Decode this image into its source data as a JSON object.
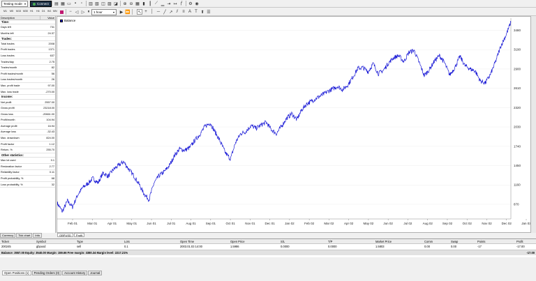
{
  "toolbar": {
    "mode": "Testing mode",
    "connect_label": "Connect",
    "timeframes": [
      "M1",
      "M5",
      "M15",
      "M30",
      "H1",
      "H4",
      "D1",
      "W1",
      "MN"
    ],
    "period": "1 hour"
  },
  "stats": {
    "col_description": "Description",
    "col_value": "Value",
    "sections": [
      {
        "title": "Time:",
        "rows": [
          [
            "Days left",
            "731"
          ],
          [
            "Months left",
            "24.37"
          ]
        ]
      },
      {
        "title": "Trades:",
        "rows": [
          [
            "Total trades",
            "2008"
          ],
          [
            "Profit trades",
            "1371"
          ],
          [
            "Loss trades",
            "637"
          ],
          [
            "Trades/day",
            "2.75"
          ],
          [
            "Trades/month",
            "82"
          ],
          [
            "Profit trades/month",
            "56"
          ],
          [
            "Loss trades/month",
            "26"
          ],
          [
            "Max. profit trade",
            "97.00"
          ],
          [
            "Max. loss trade",
            "-270.00"
          ]
        ]
      },
      {
        "title": "Income:",
        "rows": [
          [
            "Net profit",
            "2557.00"
          ],
          [
            "Gross profit",
            "23218.00"
          ],
          [
            "Gross loss",
            "-20661.00"
          ],
          [
            "Profit/month",
            "104.94"
          ],
          [
            "Average profit",
            "16.94"
          ],
          [
            "Average loss",
            "-32.43"
          ],
          [
            "Max. drawdown",
            "824.00"
          ],
          [
            "Profit factor",
            "1.12"
          ],
          [
            "Return, %",
            "255.70"
          ]
        ]
      },
      {
        "title": "Other statistics:",
        "rows": [
          [
            "Max lot used",
            "0.1"
          ],
          [
            "Restoration factor",
            "2.77"
          ],
          [
            "Reliability factor",
            "0.11"
          ],
          [
            "Profit probability, %",
            "68"
          ],
          [
            "Loss probability, %",
            "32"
          ]
        ]
      }
    ]
  },
  "left_tabs": [
    "Currency",
    "Tick chart",
    "Info"
  ],
  "chart_tabs": [
    "GBPUSD",
    "Profit"
  ],
  "chart_data": {
    "type": "line",
    "series": [
      {
        "name": "Balance",
        "color": "#1a1ad6"
      }
    ],
    "x_ticks": [
      "Feb 01",
      "Mar 01",
      "Apr 01",
      "May 01",
      "Jun 01",
      "Jul 01",
      "Aug 01",
      "Sep 01",
      "Oct 01",
      "Nov 01",
      "Dec 01",
      "Jan 02",
      "Feb 02",
      "Mar 02",
      "Apr 02",
      "May 02",
      "Jun 02",
      "Jul 02",
      "Aug 02",
      "Sep 02",
      "Oct 02",
      "Nov 02",
      "Dec 02",
      "Jan 03"
    ],
    "y_ticks": [
      870,
      1160,
      1450,
      1740,
      2030,
      2320,
      2610,
      2900,
      3190,
      3480
    ],
    "ylim": [
      650,
      3600
    ],
    "points": [
      [
        0.0,
        890
      ],
      [
        0.5,
        760
      ],
      [
        1.0,
        920
      ],
      [
        1.5,
        830
      ],
      [
        2.0,
        1010
      ],
      [
        2.5,
        1120
      ],
      [
        3.0,
        1180
      ],
      [
        3.5,
        1260
      ],
      [
        4.0,
        1190
      ],
      [
        4.5,
        1340
      ],
      [
        5.0,
        1290
      ],
      [
        5.5,
        1390
      ],
      [
        6.0,
        1450
      ],
      [
        6.5,
        1510
      ],
      [
        7.0,
        1400
      ],
      [
        7.5,
        1300
      ],
      [
        8.0,
        1180
      ],
      [
        8.5,
        1030
      ],
      [
        9.0,
        940
      ],
      [
        9.5,
        1190
      ],
      [
        10.0,
        1300
      ],
      [
        10.5,
        1360
      ],
      [
        11.0,
        1450
      ],
      [
        11.5,
        1600
      ],
      [
        12.0,
        1700
      ],
      [
        12.5,
        1680
      ],
      [
        13.0,
        1720
      ],
      [
        13.5,
        1830
      ],
      [
        14.0,
        1920
      ],
      [
        14.5,
        2040
      ],
      [
        15.0,
        2090
      ],
      [
        15.5,
        1950
      ],
      [
        16.0,
        1810
      ],
      [
        16.5,
        1640
      ],
      [
        17.0,
        1550
      ],
      [
        17.5,
        1800
      ],
      [
        18.0,
        1930
      ],
      [
        18.5,
        1960
      ],
      [
        19.0,
        2050
      ],
      [
        19.5,
        2010
      ],
      [
        20.0,
        2060
      ],
      [
        20.5,
        2100
      ],
      [
        21.0,
        1990
      ],
      [
        21.5,
        1930
      ],
      [
        22.0,
        2040
      ],
      [
        22.5,
        2160
      ],
      [
        23.0,
        2230
      ],
      [
        23.5,
        2140
      ],
      [
        24.0,
        2290
      ],
      [
        24.5,
        2380
      ],
      [
        25.0,
        2420
      ],
      [
        25.5,
        2470
      ],
      [
        26.0,
        2510
      ],
      [
        26.5,
        2560
      ],
      [
        27.0,
        2600
      ],
      [
        27.5,
        2640
      ],
      [
        28.0,
        2590
      ],
      [
        28.5,
        2660
      ],
      [
        29.0,
        2780
      ],
      [
        29.5,
        2910
      ],
      [
        30.0,
        2920
      ],
      [
        30.5,
        2860
      ],
      [
        31.0,
        2980
      ],
      [
        31.5,
        2830
      ],
      [
        32.0,
        2880
      ],
      [
        32.5,
        2990
      ],
      [
        33.0,
        3070
      ],
      [
        33.5,
        3100
      ],
      [
        34.0,
        3010
      ],
      [
        34.5,
        3150
      ],
      [
        35.0,
        3180
      ],
      [
        35.5,
        3000
      ],
      [
        36.0,
        2800
      ],
      [
        36.5,
        2890
      ],
      [
        37.0,
        3020
      ],
      [
        37.5,
        3100
      ],
      [
        38.0,
        2990
      ],
      [
        38.5,
        2810
      ],
      [
        39.0,
        2920
      ],
      [
        39.5,
        3090
      ],
      [
        40.0,
        2950
      ],
      [
        40.5,
        2900
      ],
      [
        41.0,
        2870
      ],
      [
        41.5,
        2720
      ],
      [
        42.0,
        2690
      ],
      [
        42.5,
        2820
      ],
      [
        43.0,
        3010
      ],
      [
        43.5,
        3240
      ],
      [
        44.0,
        3400
      ],
      [
        44.5,
        3600
      ]
    ],
    "x_range": [
      0,
      44.5
    ],
    "legend": "top-left"
  },
  "positions": {
    "headers": [
      "Ticket",
      "Symbol",
      "Type",
      "Lots",
      "Open Time",
      "Open Price",
      "S/L",
      "T/P",
      "Market Price",
      "Comm",
      "Swap",
      "Points",
      "Profit"
    ],
    "row": [
      "200245",
      "gbpusd",
      "sell",
      "0.1",
      "2003.01.03 14:00",
      "1.5986",
      "0.0000",
      "0.0000",
      "1.5803",
      "0.00",
      "0.00",
      "-17",
      "-17.00"
    ],
    "summary": "Balance: 3557.00 Equity: 3540.00 Margin: 159.66 Free margin: 3380.34 Margin level: 2217.21%",
    "summary_value": "-17.00"
  },
  "bottom_tabs": [
    "Open Positions (1)",
    "Pending Orders (0)",
    "Account History",
    "Journal"
  ]
}
